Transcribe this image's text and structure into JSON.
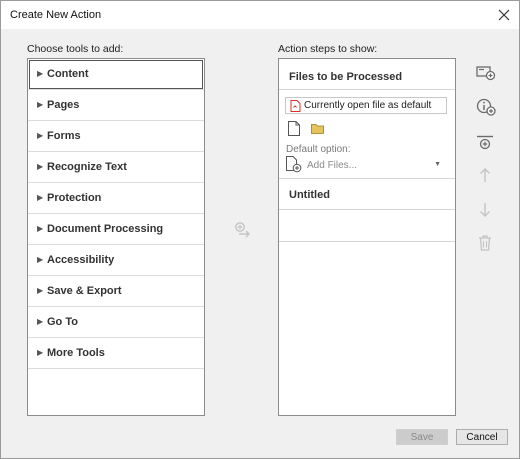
{
  "window": {
    "title": "Create New Action"
  },
  "left": {
    "label": "Choose tools to add:",
    "tools": [
      {
        "label": "Content"
      },
      {
        "label": "Pages"
      },
      {
        "label": "Forms"
      },
      {
        "label": "Recognize Text"
      },
      {
        "label": "Protection"
      },
      {
        "label": "Document Processing"
      },
      {
        "label": "Accessibility"
      },
      {
        "label": "Save & Export"
      },
      {
        "label": "Go To"
      },
      {
        "label": "More Tools"
      }
    ]
  },
  "right": {
    "label": "Action steps to show:",
    "files_header": "Files to be Processed",
    "default_file": "Currently open file as default",
    "default_option_label": "Default option:",
    "add_files_placeholder": "Add Files...",
    "untitled": "Untitled"
  },
  "buttons": {
    "save": "Save",
    "cancel": "Cancel"
  },
  "icons": [
    "close-icon",
    "caret-right-icon",
    "pdf-icon",
    "new-document-icon",
    "folder-icon",
    "add-document-icon",
    "dropdown-arrow-icon",
    "add-to-right-icon",
    "add-panel-icon",
    "instruction-icon",
    "divider-icon",
    "move-up-icon",
    "move-down-icon",
    "delete-icon"
  ],
  "colors": {
    "dialog_bg": "#f0f0f0",
    "panel_border": "#8c8c8c",
    "icon_gray": "#6b6b6b",
    "disabled_gray": "#c4c4c4",
    "pdf_red": "#d9302c",
    "folder_yellow": "#e7c35c"
  }
}
